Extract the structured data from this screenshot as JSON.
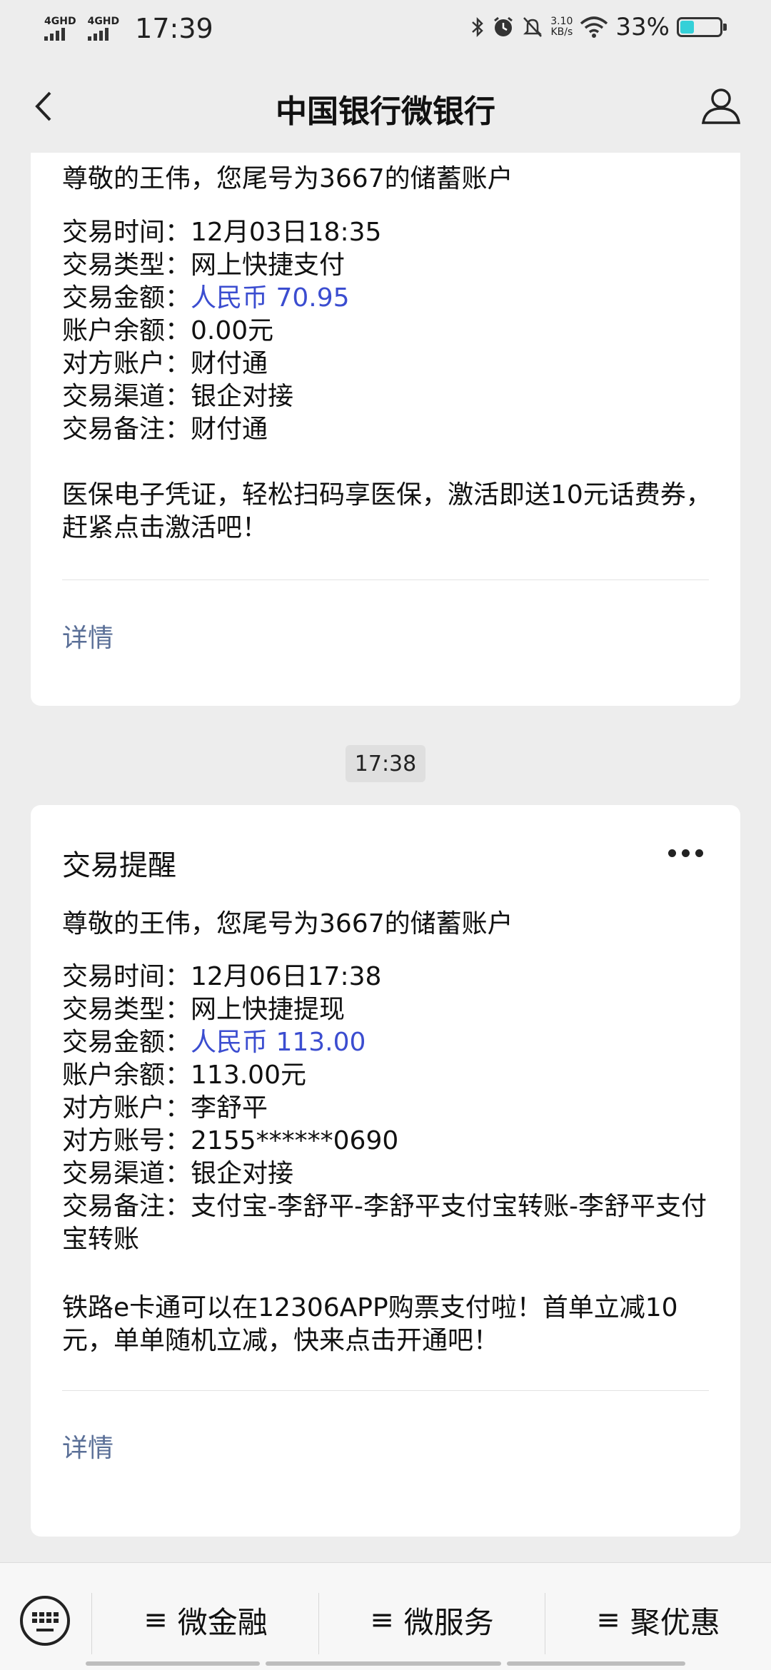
{
  "status_bar": {
    "net1": "4GHD",
    "net2": "4GHD",
    "time": "17:39",
    "speed_value": "3.10",
    "speed_unit": "KB/s",
    "battery": "33%"
  },
  "nav": {
    "title": "中国银行微银行"
  },
  "messages": [
    {
      "greeting": "尊敬的王伟，您尾号为3667的储蓄账户",
      "fields": [
        {
          "label": "交易时间：",
          "value": "12月03日18:35"
        },
        {
          "label": "交易类型：",
          "value": "网上快捷支付"
        },
        {
          "label": "交易金额：",
          "value": "人民币 70.95"
        },
        {
          "label": "账户余额：",
          "value": "0.00元"
        },
        {
          "label": "对方账户：",
          "value": "财付通"
        },
        {
          "label": "交易渠道：",
          "value": "银企对接"
        },
        {
          "label": "交易备注：",
          "value": "财付通"
        }
      ],
      "promo": "医保电子凭证，轻松扫码享医保，激活即送10元话费券，赶紧点击激活吧！",
      "detail_label": "详情"
    },
    {
      "time_chip": "17:38",
      "title": "交易提醒",
      "greeting": "尊敬的王伟，您尾号为3667的储蓄账户",
      "fields": [
        {
          "label": "交易时间：",
          "value": "12月06日17:38"
        },
        {
          "label": "交易类型：",
          "value": "网上快捷提现"
        },
        {
          "label": "交易金额：",
          "value": "人民币 113.00"
        },
        {
          "label": "账户余额：",
          "value": "113.00元"
        },
        {
          "label": "对方账户：",
          "value": "李舒平"
        },
        {
          "label": "对方账号：",
          "value": "2155******0690"
        },
        {
          "label": "交易渠道：",
          "value": "银企对接"
        },
        {
          "label": "交易备注：",
          "value": "支付宝-李舒平-李舒平支付宝转账-李舒平支付宝转账"
        }
      ],
      "promo": "铁路e卡通可以在12306APP购票支付啦！首单立减10元，单单随机立减，快来点击开通吧！",
      "detail_label": "详情"
    }
  ],
  "bottom_menu": {
    "items": [
      {
        "label": "微金融"
      },
      {
        "label": "微服务"
      },
      {
        "label": "聚优惠"
      }
    ],
    "menu_glyph": "≡"
  },
  "colors": {
    "amount": "#3b4dd0",
    "link": "#5a6f97",
    "background": "#ededed"
  },
  "icons": [
    "back-arrow-icon",
    "user-icon",
    "more-dots-icon",
    "keyboard-icon",
    "bluetooth-icon",
    "alarm-icon",
    "mute-icon",
    "wifi-icon",
    "battery-icon",
    "signal-icon"
  ]
}
